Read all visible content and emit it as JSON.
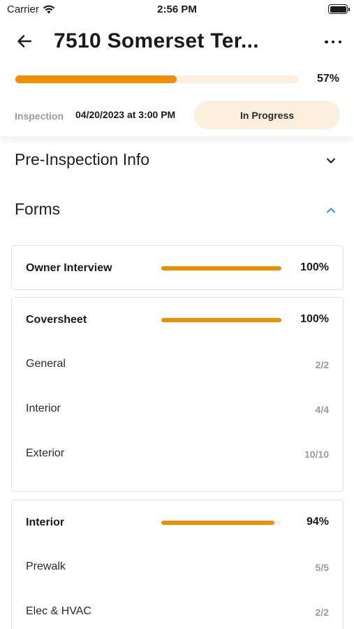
{
  "status_bar": {
    "carrier": "Carrier",
    "time": "2:56 PM"
  },
  "header": {
    "title": "7510 Somerset Ter...",
    "progress_percent": 57,
    "progress_label": "57%",
    "inspection_label": "Inspection",
    "inspection_datetime": "04/20/2023 at 3:00 PM",
    "status": "In Progress"
  },
  "sections": {
    "pre_inspection": {
      "title": "Pre-Inspection Info",
      "expanded": false
    },
    "forms": {
      "title": "Forms",
      "expanded": true
    }
  },
  "forms": [
    {
      "title": "Owner Interview",
      "percent": 100,
      "percent_label": "100%",
      "rows": []
    },
    {
      "title": "Coversheet",
      "percent": 100,
      "percent_label": "100%",
      "rows": [
        {
          "label": "General",
          "count": "2/2"
        },
        {
          "label": "Interior",
          "count": "4/4"
        },
        {
          "label": "Exterior",
          "count": "10/10"
        }
      ]
    },
    {
      "title": "Interior",
      "percent": 94,
      "percent_label": "94%",
      "rows": [
        {
          "label": "Prewalk",
          "count": "5/5"
        },
        {
          "label": "Elec & HVAC",
          "count": "2/2"
        }
      ]
    }
  ],
  "colors": {
    "accent": "#f28c00",
    "track": "#fdf0e0",
    "pill": "#fdefdd",
    "chevron_active": "#2196f3"
  },
  "icons": {
    "back": "arrow-left-icon",
    "more": "more-horizontal-icon",
    "wifi": "wifi-icon",
    "battery": "battery-icon",
    "collapsed": "chevron-down-icon",
    "expanded": "chevron-up-icon"
  }
}
